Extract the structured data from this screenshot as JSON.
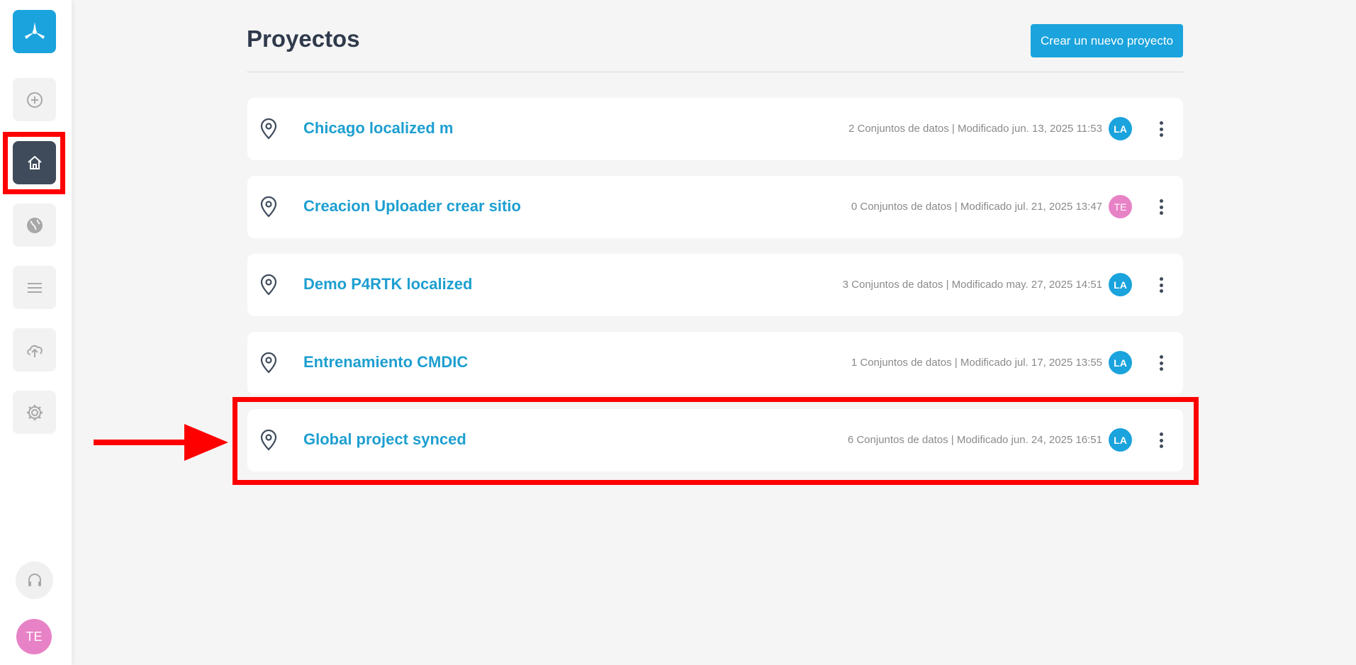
{
  "page": {
    "title": "Proyectos",
    "new_project_label": "Crear un nuevo proyecto"
  },
  "sidebar": {
    "items": [
      {
        "icon": "plus-circle-icon",
        "active": false
      },
      {
        "icon": "home-icon",
        "active": true
      },
      {
        "icon": "globe-icon",
        "active": false
      },
      {
        "icon": "menu-lines-icon",
        "active": false
      },
      {
        "icon": "cloud-upload-icon",
        "active": false
      },
      {
        "icon": "gear-icon",
        "active": false
      }
    ],
    "support_icon": "headset-icon",
    "user_initials": "TE"
  },
  "projects": [
    {
      "name": "Chicago localized m",
      "meta": "2 Conjuntos de datos | Modificado jun. 13, 2025 11:53",
      "owner": "LA",
      "owner_color": "#1aa3dc"
    },
    {
      "name": "Creacion Uploader crear sitio",
      "meta": "0 Conjuntos de datos | Modificado jul. 21, 2025 13:47",
      "owner": "TE",
      "owner_color": "#e882c6"
    },
    {
      "name": "Demo P4RTK localized",
      "meta": "3 Conjuntos de datos | Modificado may. 27, 2025 14:51",
      "owner": "LA",
      "owner_color": "#1aa3dc"
    },
    {
      "name": "Entrenamiento CMDIC",
      "meta": "1 Conjuntos de datos | Modificado jul. 17, 2025 13:55",
      "owner": "LA",
      "owner_color": "#1aa3dc"
    },
    {
      "name": "Global project synced",
      "meta": "6 Conjuntos de datos | Modificado jun. 24, 2025 16:51",
      "owner": "LA",
      "owner_color": "#1aa3dc"
    }
  ],
  "colors": {
    "accent": "#1aa3dc",
    "annotation": "#ff0000"
  }
}
